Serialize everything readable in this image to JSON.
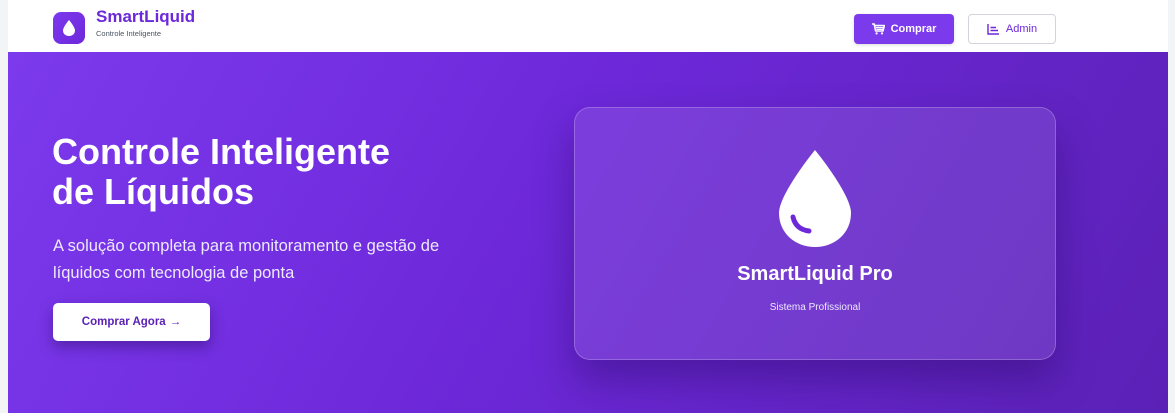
{
  "header": {
    "brand_name": "SmartLiquid",
    "brand_tagline": "Controle Inteligente",
    "buy_label": "Comprar",
    "admin_label": "Admin"
  },
  "hero": {
    "title_line1": "Controle Inteligente",
    "title_line2": "de Líquidos",
    "subtitle_line1": "A solução completa para monitoramento e gestão de",
    "subtitle_line2": "líquidos com tecnologia de ponta",
    "cta_label": "Comprar Agora",
    "cta_arrow": "→"
  },
  "card": {
    "title": "SmartLiquid Pro",
    "subtitle": "Sistema Profissional",
    "icon": "droplet-icon"
  },
  "colors": {
    "accent": "#7c3aed",
    "accent_dark": "#5b21b6",
    "white": "#ffffff"
  }
}
